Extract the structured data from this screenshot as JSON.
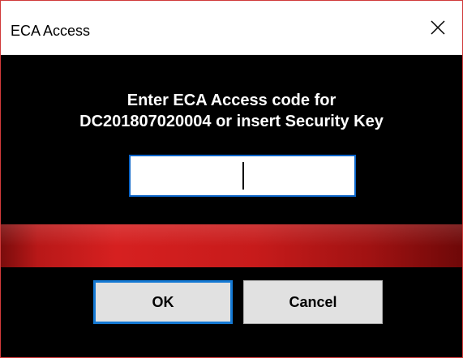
{
  "window": {
    "title": "ECA Access",
    "close_icon": "close-icon"
  },
  "dialog": {
    "prompt_line1": "Enter ECA Access code for",
    "prompt_line2": "DC201807020004 or insert Security Key",
    "code_value": "",
    "code_placeholder": ""
  },
  "buttons": {
    "ok_label": "OK",
    "cancel_label": "Cancel"
  },
  "colors": {
    "background": "#000000",
    "accent_bar": "#d62020",
    "focus_border": "#1479d4"
  }
}
